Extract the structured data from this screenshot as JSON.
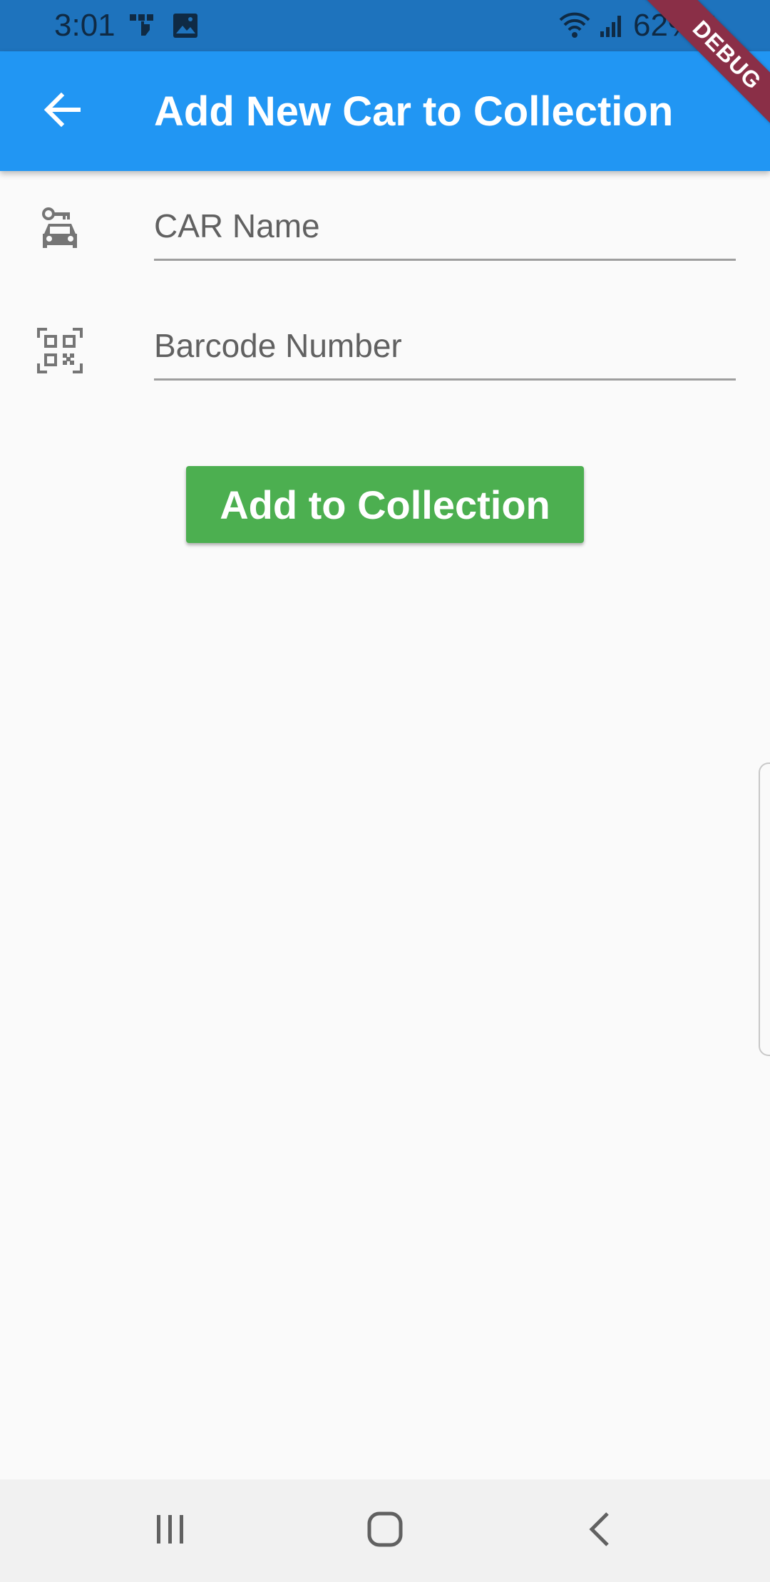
{
  "status_bar": {
    "time": "3:01",
    "battery": "62%",
    "icons": [
      "touch-icon",
      "image-icon",
      "wifi-icon",
      "signal-icon",
      "battery-icon"
    ]
  },
  "app_bar": {
    "title": "Add New Car to Collection",
    "back_icon": "arrow-back-icon"
  },
  "debug_banner": "DEBUG",
  "form": {
    "car_name": {
      "icon": "car-key-icon",
      "value": "",
      "placeholder": "CAR Name"
    },
    "barcode": {
      "icon": "qr-code-icon",
      "value": "",
      "placeholder": "Barcode Number"
    },
    "submit_label": "Add to Collection"
  },
  "nav_bar": {
    "icons": [
      "recent-apps-icon",
      "home-icon",
      "back-icon"
    ]
  },
  "colors": {
    "status_bar": "#1e73bd",
    "app_bar": "#2196f3",
    "button": "#4caf50",
    "background": "#fafafa",
    "debug_banner": "#8a2f47"
  }
}
